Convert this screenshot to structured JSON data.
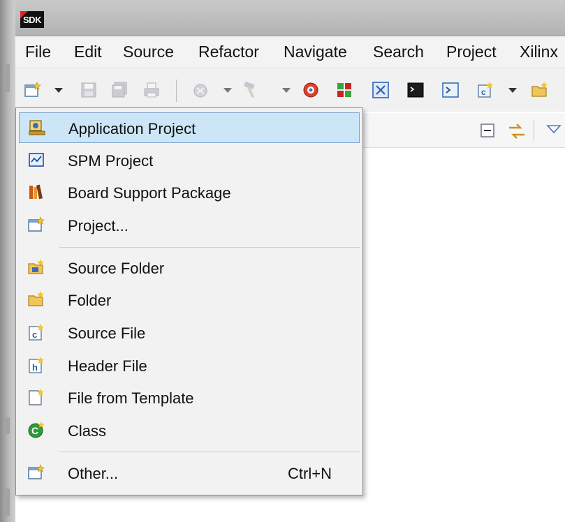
{
  "app": {
    "logo_text": "SDK"
  },
  "menubar": {
    "items": [
      "File",
      "Edit",
      "Source",
      "Refactor",
      "Navigate",
      "Search",
      "Project",
      "Xilinx"
    ]
  },
  "toolbar": {
    "icons": [
      "new-wizard-icon",
      "save-icon",
      "save-all-icon",
      "print-icon",
      "debug-icon",
      "build-hammer-icon",
      "refresh-icon",
      "program-fpga-icon",
      "xmd-icon",
      "terminal-icon",
      "console-icon",
      "new-cpp-project-icon",
      "new-source-folder-icon"
    ]
  },
  "dropdown": {
    "items": [
      {
        "label": "Application Project",
        "icon": "application-project-icon",
        "selected": true
      },
      {
        "label": "SPM Project",
        "icon": "spm-project-icon"
      },
      {
        "label": "Board Support Package",
        "icon": "board-support-package-icon"
      },
      {
        "label": "Project...",
        "icon": "project-icon"
      },
      {
        "label": "Source Folder",
        "icon": "source-folder-icon"
      },
      {
        "label": "Folder",
        "icon": "folder-icon"
      },
      {
        "label": "Source File",
        "icon": "source-file-icon"
      },
      {
        "label": "Header File",
        "icon": "header-file-icon"
      },
      {
        "label": "File from Template",
        "icon": "file-template-icon"
      },
      {
        "label": "Class",
        "icon": "class-icon"
      },
      {
        "label": "Other...",
        "icon": "other-wizard-icon",
        "accelerator": "Ctrl+N"
      }
    ]
  },
  "colors": {
    "selection_bg": "#cde6f7",
    "selection_border": "#7da2ce",
    "logo_red": "#dd2222"
  }
}
